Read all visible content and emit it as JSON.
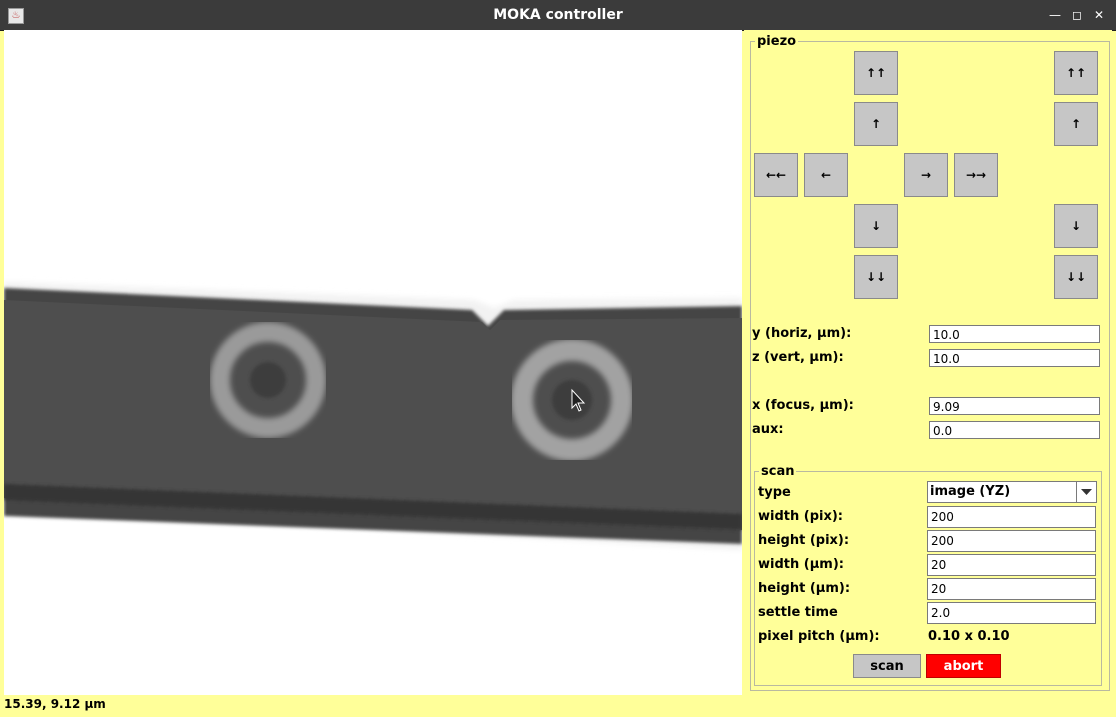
{
  "window": {
    "title": "MOKA controller",
    "icon": "java-app-icon",
    "controls": [
      "minimize-icon",
      "maximize-icon",
      "close-icon"
    ]
  },
  "status": {
    "coordinates": "15.39, 9.12 µm"
  },
  "piezo": {
    "legend": "piezo",
    "buttons": {
      "yz_up_fast": "↑↑",
      "yz_up": "↑",
      "left_fast": "←←",
      "left": "←",
      "right": "→",
      "right_fast": "→→",
      "yz_down": "↓",
      "yz_down_fast": "↓↓",
      "x_up_fast": "↑↑",
      "x_up": "↑",
      "x_down": "↓",
      "x_down_fast": "↓↓"
    },
    "fields": {
      "y_label": "y (horiz, µm):",
      "y_value": "10.0",
      "z_label": "z (vert, µm):",
      "z_value": "10.0",
      "x_label": "x (focus, µm):",
      "x_value": "9.09",
      "aux_label": "aux:",
      "aux_value": "0.0"
    }
  },
  "scan": {
    "legend": "scan",
    "type_label": "type",
    "type_value": "image (YZ)",
    "width_pix_label": "width (pix):",
    "width_pix_value": "200",
    "height_pix_label": "height (pix):",
    "height_pix_value": "200",
    "width_um_label": "width (µm):",
    "width_um_value": "20",
    "height_um_label": "height (µm):",
    "height_um_value": "20",
    "settle_label": "settle time",
    "settle_value": "2.0",
    "pitch_label": "pixel pitch (µm):",
    "pitch_value": "0.10 x 0.10",
    "scan_button": "scan",
    "abort_button": "abort"
  },
  "colors": {
    "panel_bg": "#ffff99",
    "titlebar_bg": "#3b3b3b",
    "button_bg": "#c6c6c6",
    "abort_bg": "#ff0000"
  }
}
